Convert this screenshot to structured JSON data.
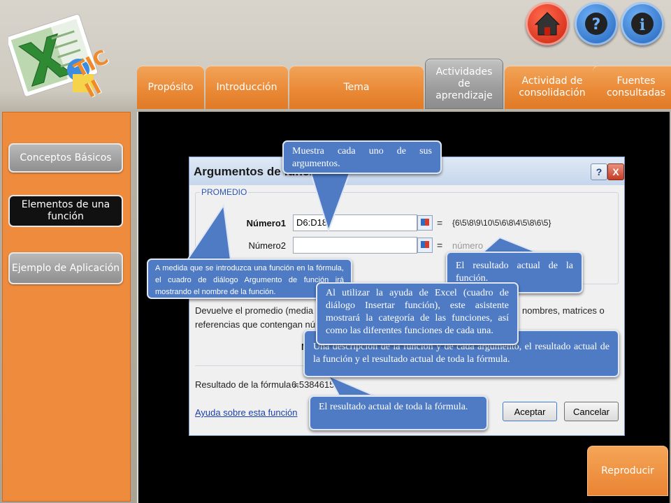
{
  "nav": {
    "tabs": [
      {
        "label": "Propósito"
      },
      {
        "label": "Introducción"
      },
      {
        "label": "Tema"
      },
      {
        "label": "Actividades de aprendizaje",
        "active": true
      },
      {
        "label": "Actividad de consolidación"
      },
      {
        "label": "Fuentes consultadas"
      }
    ],
    "home_icon": "home-icon",
    "help_icon": "question-icon",
    "info_icon": "info-icon"
  },
  "logo": {
    "text": "TIC II"
  },
  "sidebar": {
    "items": [
      {
        "label": "Conceptos Básicos"
      },
      {
        "label": "Elementos de una función",
        "active": true
      },
      {
        "label": "Ejemplo de Aplicación"
      }
    ]
  },
  "dialog": {
    "title": "Argumentos de función",
    "help_btn": "?",
    "close_btn": "X",
    "group_label": "PROMEDIO",
    "field1_label": "Número1",
    "field1_value": "D6:D18",
    "field1_result": "{6\\5\\8\\9\\10\\5\\6\\8\\4\\5\\8\\6\\5}",
    "field2_label": "Número2",
    "field2_result": "número",
    "eq": "=",
    "desc_line1": "Devuelve el promedio (media aritmética)",
    "desc_line1_end": "nombres, matrices o",
    "desc_line2": "referencias que contengan números.",
    "desc_line3": "N",
    "result_label": "Resultado de la fórmula =",
    "result_value": "6.538461538",
    "help_link": "Ayuda sobre esta función",
    "ok": "Aceptar",
    "cancel": "Cancelar"
  },
  "callouts": {
    "args": "Muestra cada uno de sus argumentos.",
    "name": "A medida que se introduzca una función en la fórmula, el cuadro de diálogo Argumento de función irá mostrando el nombre de la función.",
    "result_fn": "El resultado actual de la función.",
    "assistant": "Al utilizar la ayuda de Excel (cuadro de diálogo Insertar función), este asistente mostrará la categoría de las funciones, así como las diferentes funciones de cada una.",
    "description": "Una descripción de la función y de cada argumento, el resultado actual de la función y el resultado actual de toda la fórmula.",
    "result_formula": "El resultado actual de toda la fórmula."
  },
  "reproduce": "Reproducir",
  "colors": {
    "orange": "#ea8a37",
    "callout": "#4e7bc4",
    "grey_tab": "#9c9c9c"
  }
}
